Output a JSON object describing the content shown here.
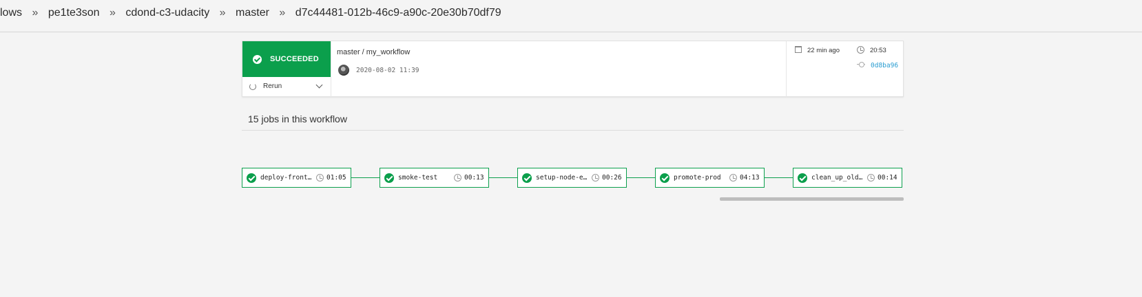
{
  "breadcrumb": {
    "items": [
      "lows",
      "pe1te3son",
      "cdond-c3-udacity",
      "master",
      "d7c44481-012b-46c9-a90c-20e30b70df79"
    ],
    "separator": "»"
  },
  "workflow_card": {
    "status_label": "SUCCEEDED",
    "rerun_label": "Rerun",
    "title": "master / my_workflow",
    "date": "2020-08-02 11:39",
    "time_ago": "22 min ago",
    "duration": "20:53",
    "commit_hash": "0d8ba96"
  },
  "jobs_section": {
    "title": "15 jobs in this workflow"
  },
  "jobs": [
    {
      "name": "deploy-frontend",
      "time": "01:05",
      "status": "success"
    },
    {
      "name": "smoke-test",
      "time": "00:13",
      "status": "success"
    },
    {
      "name": "setup-node-exporter",
      "time": "00:26",
      "status": "success"
    },
    {
      "name": "promote-prod",
      "time": "04:13",
      "status": "success"
    },
    {
      "name": "clean_up_old_stack",
      "time": "00:14",
      "status": "success"
    }
  ],
  "colors": {
    "success": "#0b9f4c",
    "link": "#2a9dd1",
    "background": "#f4f4f4"
  }
}
